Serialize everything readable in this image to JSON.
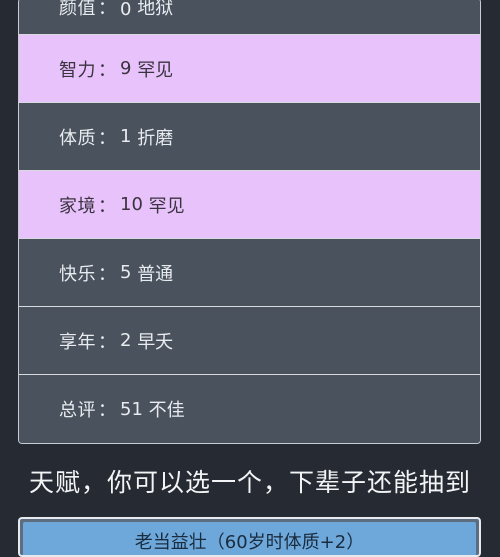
{
  "attributes": [
    {
      "name": "颜值",
      "value": "0",
      "rating": "地狱",
      "highlight": false
    },
    {
      "name": "智力",
      "value": "9",
      "rating": "罕见",
      "highlight": true
    },
    {
      "name": "体质",
      "value": "1",
      "rating": "折磨",
      "highlight": false
    },
    {
      "name": "家境",
      "value": "10",
      "rating": "罕见",
      "highlight": true
    },
    {
      "name": "快乐",
      "value": "5",
      "rating": "普通",
      "highlight": false
    },
    {
      "name": "享年",
      "value": "2",
      "rating": "早夭",
      "highlight": false
    },
    {
      "name": "总评",
      "value": "51",
      "rating": "不佳",
      "highlight": false
    }
  ],
  "separator": "：",
  "heading": "天赋，你可以选一个，下辈子还能抽到",
  "talents": [
    {
      "label": "老当益壮（60岁时体质+2）"
    }
  ],
  "colors": {
    "background": "#262a33",
    "row": "#4a525d",
    "row_highlight": "#e8c3fb",
    "talent": "#6ea7d9"
  }
}
